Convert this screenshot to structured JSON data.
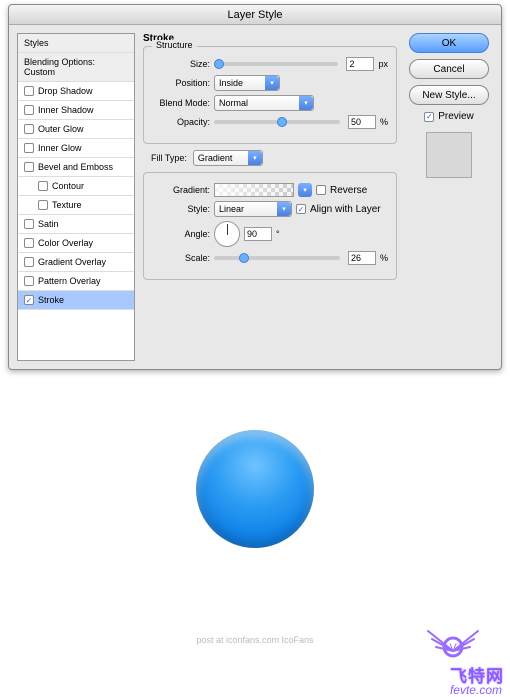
{
  "window": {
    "title": "Layer Style"
  },
  "sidebar": {
    "header": "Styles",
    "blending": "Blending Options: Custom",
    "items": [
      {
        "label": "Drop Shadow",
        "checked": false
      },
      {
        "label": "Inner Shadow",
        "checked": false
      },
      {
        "label": "Outer Glow",
        "checked": false
      },
      {
        "label": "Inner Glow",
        "checked": false
      },
      {
        "label": "Bevel and Emboss",
        "checked": false
      },
      {
        "label": "Contour",
        "checked": false,
        "indent": true
      },
      {
        "label": "Texture",
        "checked": false,
        "indent": true
      },
      {
        "label": "Satin",
        "checked": false
      },
      {
        "label": "Color Overlay",
        "checked": false
      },
      {
        "label": "Gradient Overlay",
        "checked": false
      },
      {
        "label": "Pattern Overlay",
        "checked": false
      },
      {
        "label": "Stroke",
        "checked": true,
        "selected": true
      }
    ]
  },
  "panel": {
    "title": "Stroke",
    "structure": {
      "legend": "Structure",
      "size_label": "Size:",
      "size_value": "2",
      "size_unit": "px",
      "position_label": "Position:",
      "position_value": "Inside",
      "blend_label": "Blend Mode:",
      "blend_value": "Normal",
      "opacity_label": "Opacity:",
      "opacity_value": "50",
      "opacity_unit": "%"
    },
    "fill": {
      "type_label": "Fill Type:",
      "type_value": "Gradient",
      "gradient_label": "Gradient:",
      "reverse_label": "Reverse",
      "style_label": "Style:",
      "style_value": "Linear",
      "align_label": "Align with Layer",
      "angle_label": "Angle:",
      "angle_value": "90",
      "angle_unit": "°",
      "scale_label": "Scale:",
      "scale_value": "26",
      "scale_unit": "%"
    }
  },
  "buttons": {
    "ok": "OK",
    "cancel": "Cancel",
    "new_style": "New Style...",
    "preview": "Preview"
  },
  "caption": "post at iconfans.com IcoFans",
  "logo": {
    "top": "飞特网",
    "bottom": "fevte.com"
  }
}
